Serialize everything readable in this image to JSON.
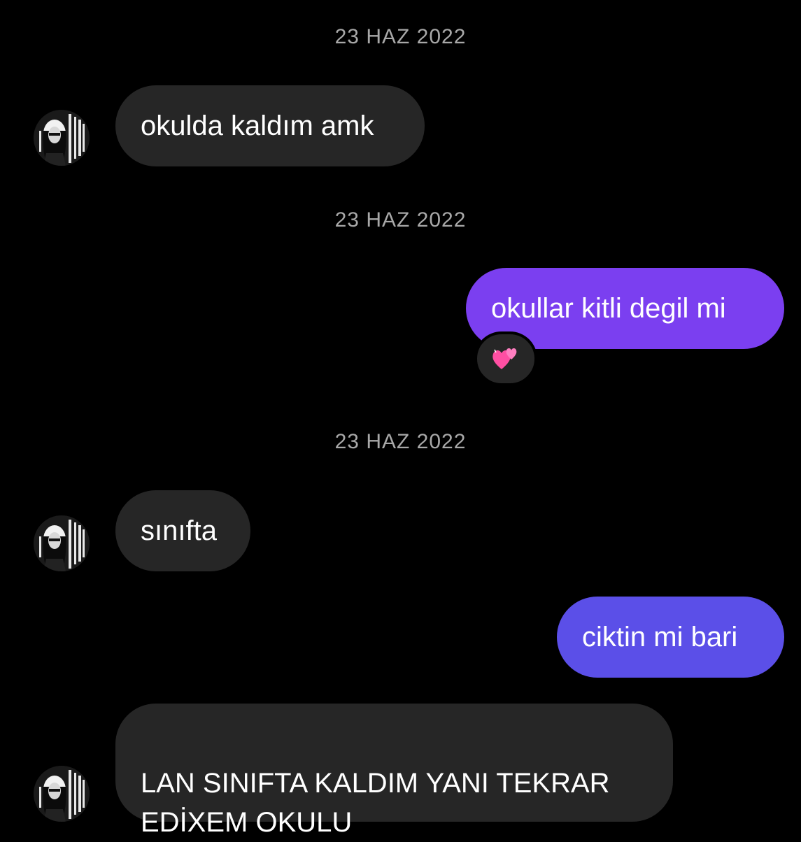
{
  "thread": {
    "date_1": "23 HAZ 2022",
    "date_2": "23 HAZ 2022",
    "date_3": "23 HAZ 2022",
    "messages": [
      {
        "text": "okulda kaldım amk"
      },
      {
        "text": "okullar kitli degil mi",
        "reaction": "two-hearts-emoji"
      },
      {
        "text": "sınıfta"
      },
      {
        "text": "ciktin mi bari"
      },
      {
        "text": "LAN SINIFTA KALDIM YANI TEKRAR\nEDİXEM OKULU"
      }
    ]
  },
  "colors": {
    "background": "#000000",
    "incoming_bubble": "#262626",
    "outgoing_bubble_1": "#7b3ff0",
    "outgoing_bubble_2": "#5b4fe8",
    "timestamp_text": "#a8a8a8"
  },
  "icons": {
    "avatar": "contact-avatar-icon",
    "reaction": "two-hearts-emoji-icon"
  }
}
